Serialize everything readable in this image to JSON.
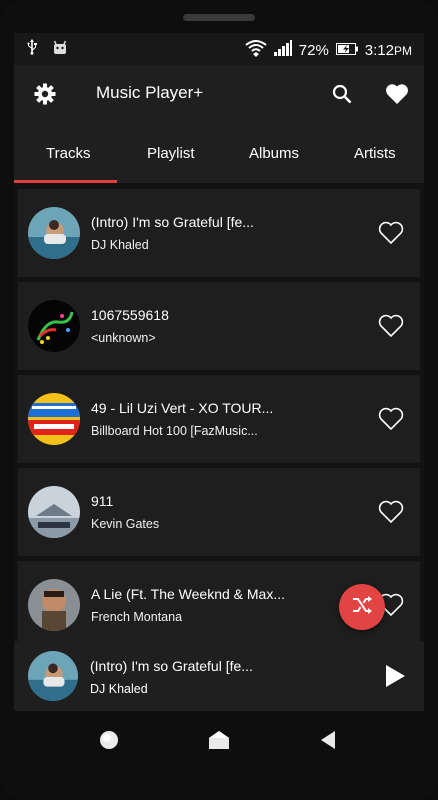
{
  "status_bar": {
    "battery": "72%",
    "time": "3:12",
    "ampm": "PM",
    "icons": [
      "usb-icon",
      "android-debug-icon",
      "wifi-icon",
      "signal-icon",
      "battery-charging-icon"
    ]
  },
  "app": {
    "title": "Music Player+",
    "icons": [
      "gear-icon",
      "search-icon",
      "heart-filled-icon"
    ]
  },
  "tabs": [
    {
      "label": "Tracks",
      "selected": true
    },
    {
      "label": "Playlist",
      "selected": false
    },
    {
      "label": "Albums",
      "selected": false
    },
    {
      "label": "Artists",
      "selected": false
    }
  ],
  "tracks": [
    {
      "title": "(Intro) I'm so Grateful [fe...",
      "artist": "DJ Khaled"
    },
    {
      "title": "1067559618",
      "artist": "<unknown>"
    },
    {
      "title": "49 - Lil Uzi Vert - XO TOUR...",
      "artist": "Billboard Hot 100 [FazMusic..."
    },
    {
      "title": "911",
      "artist": "Kevin Gates"
    },
    {
      "title": "A Lie (Ft. The Weeknd & Max...",
      "artist": "French Montana"
    }
  ],
  "now_playing": {
    "title": "(Intro) I'm so Grateful [fe...",
    "artist": "DJ Khaled",
    "icons": [
      "play-icon"
    ]
  },
  "fab": {
    "icon": "shuffle-icon"
  },
  "nav": {
    "icons": [
      "home-circle-icon",
      "home-icon",
      "back-icon"
    ]
  },
  "colors": {
    "accent": "#e53e3e",
    "background": "#1f1f1f"
  }
}
